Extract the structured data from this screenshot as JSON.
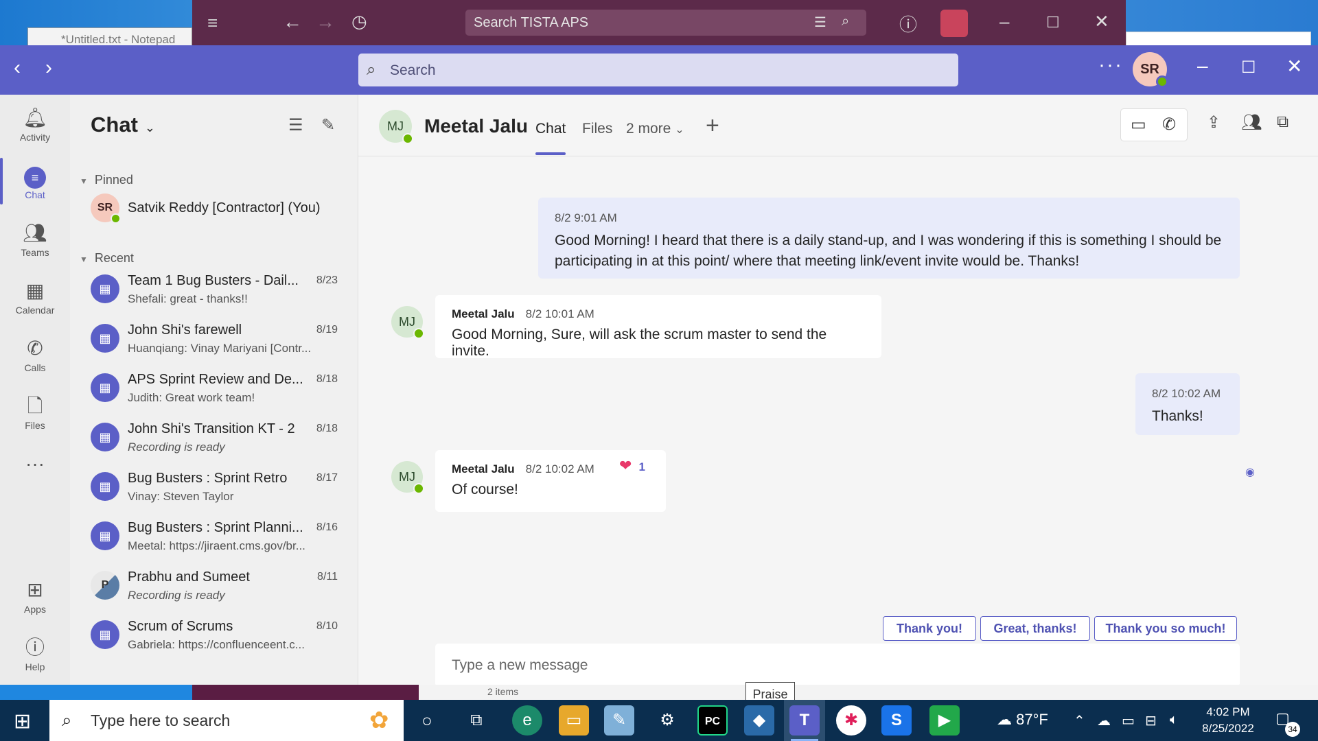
{
  "desktop": {
    "notepad_title": "*Untitled.txt - Notepad"
  },
  "back_app": {
    "search_placeholder": "Search TISTA APS"
  },
  "teams": {
    "search_placeholder": "Search",
    "user_initials": "SR",
    "rail": [
      {
        "label": "Activity",
        "icon": "bell-icon"
      },
      {
        "label": "Chat",
        "icon": "chat-icon"
      },
      {
        "label": "Teams",
        "icon": "teams-icon"
      },
      {
        "label": "Calendar",
        "icon": "calendar-icon"
      },
      {
        "label": "Calls",
        "icon": "phone-icon"
      },
      {
        "label": "Files",
        "icon": "file-icon"
      },
      {
        "label": "Apps",
        "icon": "apps-icon"
      },
      {
        "label": "Help",
        "icon": "help-icon"
      }
    ],
    "chatlist": {
      "title": "Chat",
      "pinned_label": "Pinned",
      "recent_label": "Recent",
      "pinned": [
        {
          "initials": "SR",
          "name": "Satvik Reddy [Contractor] (You)"
        }
      ],
      "recent": [
        {
          "name": "Team 1 Bug Busters - Dail...",
          "preview": "Shefali: great - thanks!!",
          "date": "8/23"
        },
        {
          "name": "John Shi's farewell",
          "preview": "Huanqiang: Vinay Mariyani [Contr...",
          "date": "8/19"
        },
        {
          "name": "APS Sprint Review and De...",
          "preview": "Judith: Great work team!",
          "date": "8/18"
        },
        {
          "name": "John Shi's Transition KT - 2",
          "preview": "Recording is ready",
          "date": "8/18"
        },
        {
          "name": "Bug Busters : Sprint Retro",
          "preview": "Vinay: Steven Taylor",
          "date": "8/17"
        },
        {
          "name": "Bug Busters : Sprint Planni...",
          "preview": "Meetal: https://jiraent.cms.gov/br...",
          "date": "8/16"
        },
        {
          "name": "Prabhu and Sumeet",
          "preview": "Recording is ready",
          "date": "8/11",
          "initial": "P"
        },
        {
          "name": "Scrum of Scrums",
          "preview": "Gabriela: https://confluenceent.c...",
          "date": "8/10"
        }
      ]
    },
    "conversation": {
      "contact_initials": "MJ",
      "contact_name": "Meetal Jalu",
      "tabs": [
        "Chat",
        "Files",
        "2 more"
      ],
      "messages": [
        {
          "from": "me",
          "time": "8/2 9:01 AM",
          "text": "Good Morning! I heard that there is a daily stand-up, and I was wondering if this is something I should be participating in at this point/ where that meeting link/event invite would be. Thanks!"
        },
        {
          "from": "Meetal Jalu",
          "time": "8/2 10:01 AM",
          "text": "Good Morning, Sure, will ask the scrum master to send the invite."
        },
        {
          "from": "me",
          "time": "8/2 10:02 AM",
          "text": "Thanks!"
        },
        {
          "from": "Meetal Jalu",
          "time": "8/2 10:02 AM",
          "text": "Of course!",
          "reaction_count": "1"
        }
      ],
      "suggested_replies": [
        "Thank you!",
        "Great, thanks!",
        "Thank you so much!"
      ],
      "compose_placeholder": "Type a new message",
      "tooltip": "Praise"
    }
  },
  "under_strip": {
    "status_text": "2 items"
  },
  "taskbar": {
    "search_placeholder": "Type here to search",
    "weather": "87°F",
    "time": "4:02 PM",
    "date": "8/25/2022",
    "notifications": "34"
  }
}
